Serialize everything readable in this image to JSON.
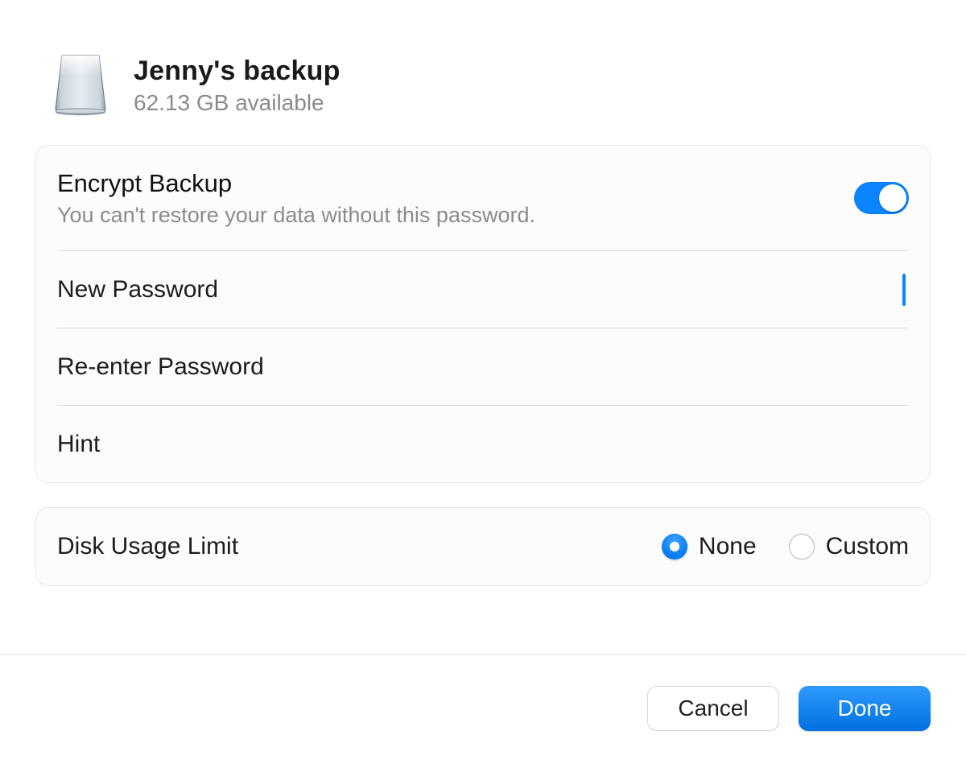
{
  "disk": {
    "name": "Jenny's backup",
    "available": "62.13 GB available",
    "icon": "external-disk-icon"
  },
  "encrypt": {
    "title": "Encrypt Backup",
    "description": "You can't restore your data without this password.",
    "enabled": true,
    "fields": {
      "new_password_label": "New Password",
      "new_password_value": "",
      "reenter_password_label": "Re-enter Password",
      "reenter_password_value": "",
      "hint_label": "Hint",
      "hint_value": ""
    }
  },
  "disk_usage": {
    "label": "Disk Usage Limit",
    "selected": "none",
    "options": {
      "none_label": "None",
      "custom_label": "Custom"
    }
  },
  "footer": {
    "cancel_label": "Cancel",
    "done_label": "Done"
  },
  "colors": {
    "accent": "#0a84ff"
  }
}
